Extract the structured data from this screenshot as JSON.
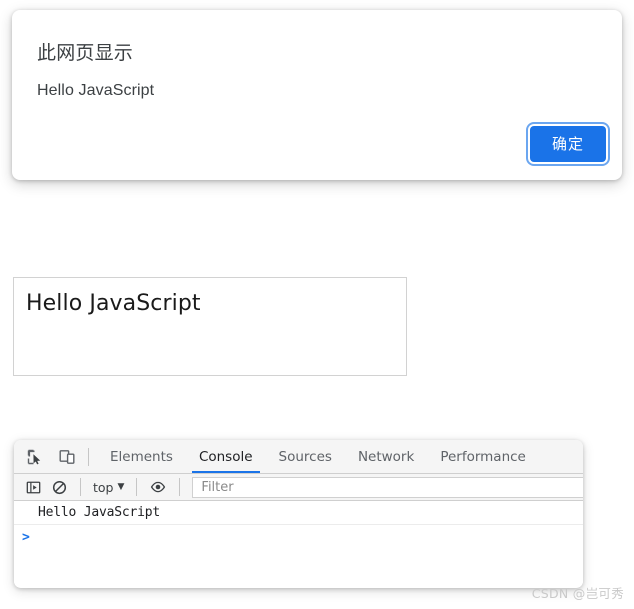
{
  "alert_dialog": {
    "title": "此网页显示",
    "message": "Hello JavaScript",
    "ok_label": "确定",
    "accent_color": "#1a73e8",
    "focus_ring_color": "#6ba6f0"
  },
  "content_box": {
    "text": "Hello JavaScript"
  },
  "devtools": {
    "icons": {
      "inspect": "inspect-element-icon",
      "device": "device-toolbar-icon"
    },
    "tabs": [
      {
        "label": "Elements",
        "active": false
      },
      {
        "label": "Console",
        "active": true
      },
      {
        "label": "Sources",
        "active": false
      },
      {
        "label": "Network",
        "active": false
      },
      {
        "label": "Performance",
        "active": false
      }
    ],
    "active_tab_underline_color": "#1a73e8",
    "console_toolbar": {
      "sidebar_toggle": "console-sidebar-icon",
      "clear_console": "clear-console-icon",
      "context_label": "top",
      "context_caret": "▼",
      "eye_icon": "live-expression-eye-icon",
      "filter_placeholder": "Filter"
    },
    "console_body": {
      "log_lines": [
        "Hello JavaScript"
      ],
      "prompt_symbol": ">",
      "prompt_color": "#1a73e8"
    }
  },
  "watermark": {
    "text": "CSDN @岂可秀"
  }
}
